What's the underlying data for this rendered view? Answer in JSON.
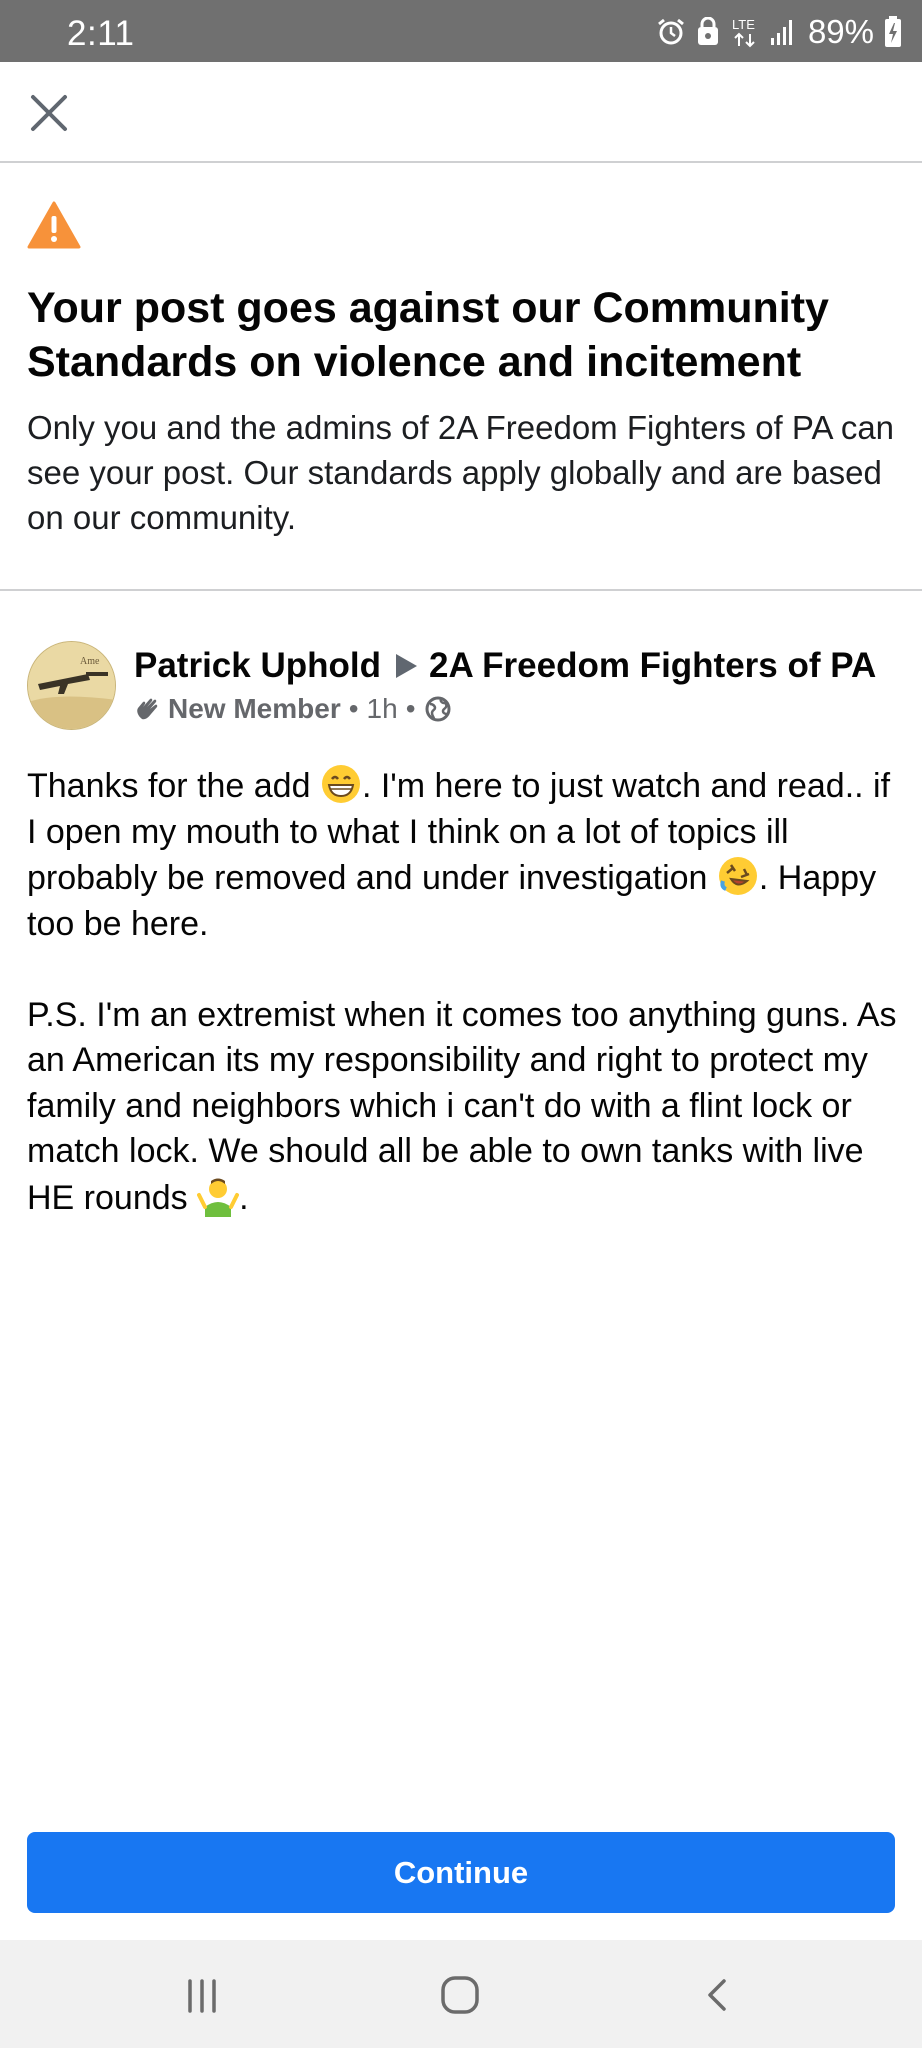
{
  "status_bar": {
    "time": "2:11",
    "battery": "89%",
    "network": "LTE",
    "icons": [
      "alarm-icon",
      "lock-icon",
      "lte-icon",
      "signal-icon",
      "battery-charging-icon"
    ]
  },
  "top_bar": {
    "close_icon": "close-icon"
  },
  "warning": {
    "icon": "warning-icon",
    "icon_color": "#f7923a",
    "title": "Your post goes against our Community Standards on violence and incitement",
    "description": "Only you and the admins of 2A Freedom Fighters of PA can see your post.  Our standards apply globally and are based on our community."
  },
  "post": {
    "author": "Patrick Uphold",
    "group": "2A Freedom Fighters of PA",
    "badge": "New Member",
    "time": "1h",
    "privacy_icon": "globe-icon",
    "paragraph1_a": "Thanks for the add ",
    "paragraph1_b": ". I'm here to just watch and read.. if I open my mouth to what I think on a lot of topics ill probably be removed and under investigation ",
    "paragraph1_c": ". Happy too be here.",
    "paragraph2_a": "P.S. I'm an extremist when it comes too anything guns. As an American its my responsibility and right to protect my family and neighbors which i can't do with a flint lock or match lock. We should all be able to own tanks with live HE rounds ",
    "paragraph2_b": "."
  },
  "actions": {
    "continue_label": "Continue",
    "accent": "#1877f2"
  },
  "nav_bar": {
    "icons": [
      "recent-apps-icon",
      "home-icon",
      "back-icon"
    ]
  }
}
